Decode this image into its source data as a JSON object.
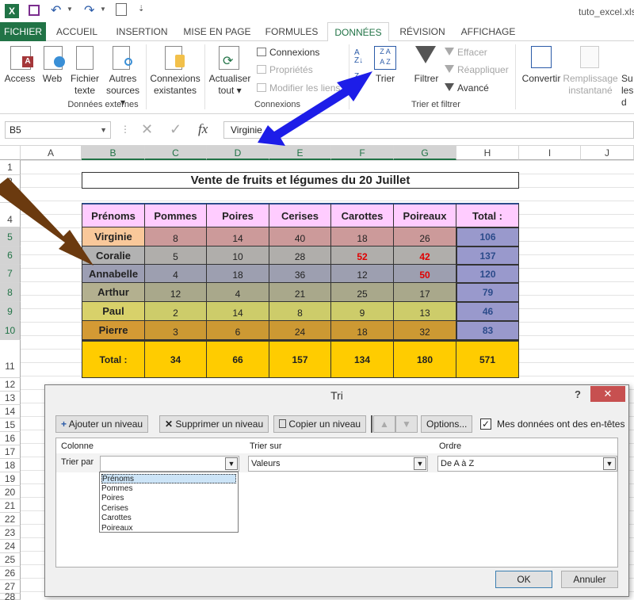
{
  "window": {
    "filename": "tuto_excel.xlsx"
  },
  "tabs": [
    {
      "label": "FICHIER"
    },
    {
      "label": "ACCUEIL"
    },
    {
      "label": "INSERTION"
    },
    {
      "label": "MISE EN PAGE"
    },
    {
      "label": "FORMULES"
    },
    {
      "label": "DONNÉES"
    },
    {
      "label": "RÉVISION"
    },
    {
      "label": "AFFICHAGE"
    }
  ],
  "ribbon": {
    "access": "Access",
    "web": "Web",
    "fichier_texte": [
      "Fichier",
      "texte"
    ],
    "autres_sources": [
      "Autres",
      "sources ▾"
    ],
    "connexions_existantes": [
      "Connexions",
      "existantes"
    ],
    "group_externes": "Données externes",
    "actualiser": [
      "Actualiser",
      "tout ▾"
    ],
    "connexions": "Connexions",
    "proprietes": "Propriétés",
    "modifier_liens": "Modifier les liens",
    "group_connexions": "Connexions",
    "trier": "Trier",
    "filtrer": "Filtrer",
    "effacer": "Effacer",
    "reappliquer": "Réappliquer",
    "avance": "Avancé",
    "group_trier": "Trier et filtrer",
    "convertir": "Convertir",
    "remplissage": [
      "Remplissage",
      "instantané"
    ],
    "suppr": [
      "Su",
      "les d"
    ]
  },
  "formula_bar": {
    "name_box": "B5",
    "content": "Virginie",
    "fx": "fx"
  },
  "columns": [
    "A",
    "B",
    "C",
    "D",
    "E",
    "F",
    "G",
    "H",
    "I",
    "J"
  ],
  "rows": [
    "1",
    "2",
    "3",
    "4",
    "5",
    "6",
    "7",
    "8",
    "9",
    "10",
    "11",
    "12",
    "13",
    "14",
    "15",
    "16",
    "17",
    "18",
    "19",
    "20",
    "21",
    "22",
    "23",
    "24",
    "25",
    "26",
    "27",
    "28"
  ],
  "sheet": {
    "title": "Vente de fruits et légumes du 20 Juillet",
    "headers": [
      "Prénoms",
      "Pommes",
      "Poires",
      "Cerises",
      "Carottes",
      "Poireaux",
      "Total :"
    ],
    "data": [
      {
        "name": "Virginie",
        "values": [
          "8",
          "14",
          "40",
          "18",
          "26"
        ],
        "total": "106"
      },
      {
        "name": "Coralie",
        "values": [
          "5",
          "10",
          "28",
          "52",
          "42"
        ],
        "total": "137"
      },
      {
        "name": "Annabelle",
        "values": [
          "4",
          "18",
          "36",
          "12",
          "50"
        ],
        "total": "120"
      },
      {
        "name": "Arthur",
        "values": [
          "12",
          "4",
          "21",
          "25",
          "17"
        ],
        "total": "79"
      },
      {
        "name": "Paul",
        "values": [
          "2",
          "14",
          "8",
          "9",
          "13"
        ],
        "total": "46"
      },
      {
        "name": "Pierre",
        "values": [
          "3",
          "6",
          "24",
          "18",
          "32"
        ],
        "total": "83"
      }
    ],
    "totals_label": "Total :",
    "totals": [
      "34",
      "66",
      "157",
      "134",
      "180",
      "571"
    ],
    "row_colors": [
      "#cc9a9a",
      "#b0aeab",
      "#9d9fb0",
      "#a9a88b",
      "#cdcc6a",
      "#cc9933"
    ],
    "name_colors": [
      "#f9c89a",
      "#b2b2b2",
      "#9c9eb3",
      "#b3b08f",
      "#d8d16a",
      "#d49a34"
    ],
    "total_col_color": "#9999cc",
    "totals_color": "#ffcc00",
    "header_color": "#ffccff"
  },
  "dialog": {
    "title": "Tri",
    "help": "?",
    "close": "✕",
    "add_level": "Ajouter un niveau",
    "delete_level": "Supprimer un niveau",
    "copy_level": "Copier un niveau",
    "options": "Options...",
    "headers_checkbox": "Mes données ont des en-têtes",
    "col_header": "Colonne",
    "sort_on_header": "Trier sur",
    "order_header": "Ordre",
    "sort_by": "Trier par",
    "sort_on_value": "Valeurs",
    "order_value": "De A à Z",
    "dropdown_options": [
      "Prénoms",
      "Pommes",
      "Poires",
      "Cerises",
      "Carottes",
      "Poireaux"
    ],
    "ok": "OK",
    "cancel": "Annuler"
  },
  "colors": {
    "excel_green": "#217346",
    "arrow_blue": "#1d1de8",
    "arrow_brown": "#6b3a0f",
    "arrow_red": "#ee1010"
  }
}
